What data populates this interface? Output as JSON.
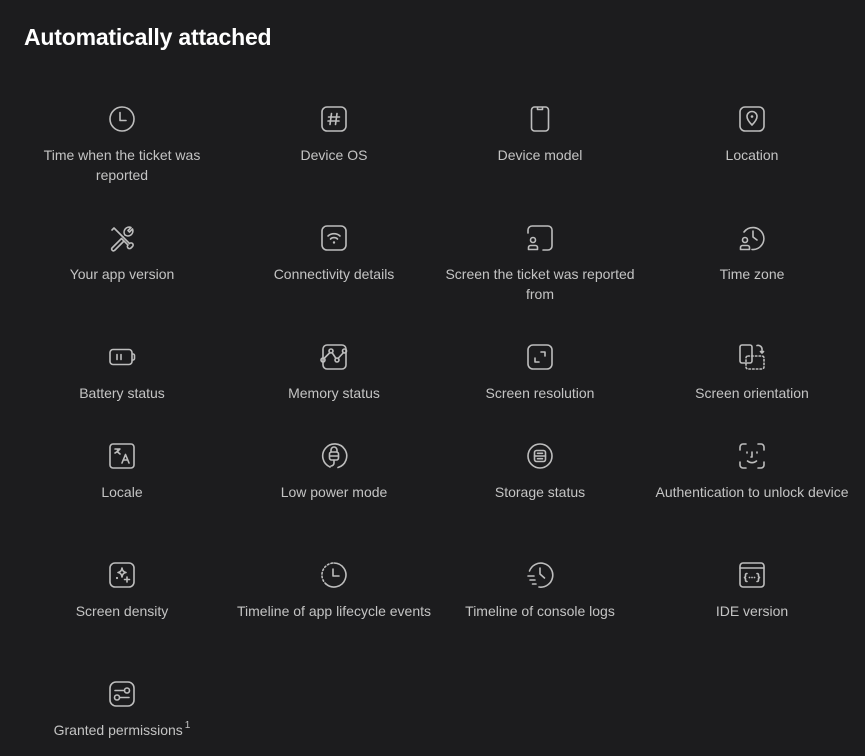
{
  "section_title": "Automatically attached",
  "items": [
    {
      "label": "Time when the ticket was reported",
      "icon": "clock-icon"
    },
    {
      "label": "Device OS",
      "icon": "hash-icon"
    },
    {
      "label": "Device model",
      "icon": "phone-icon"
    },
    {
      "label": "Location",
      "icon": "location-pin-icon"
    },
    {
      "label": "Your app version",
      "icon": "tools-icon"
    },
    {
      "label": "Connectivity details",
      "icon": "wifi-icon"
    },
    {
      "label": "Screen the ticket was reported from",
      "icon": "screen-user-icon"
    },
    {
      "label": "Time zone",
      "icon": "user-clock-icon"
    },
    {
      "label": "Battery status",
      "icon": "battery-icon"
    },
    {
      "label": "Memory status",
      "icon": "chart-graph-icon"
    },
    {
      "label": "Screen resolution",
      "icon": "resize-icon"
    },
    {
      "label": "Screen orientation",
      "icon": "rotate-screen-icon"
    },
    {
      "label": "Locale",
      "icon": "translate-icon"
    },
    {
      "label": "Low power mode",
      "icon": "plug-icon"
    },
    {
      "label": "Storage status",
      "icon": "storage-icon"
    },
    {
      "label": "Authentication to unlock device",
      "icon": "face-id-icon"
    },
    {
      "label": "Screen density",
      "icon": "sparkles-icon"
    },
    {
      "label": "Timeline of app lifecycle events",
      "icon": "dotted-clock-icon"
    },
    {
      "label": "Timeline of console logs",
      "icon": "history-lines-icon"
    },
    {
      "label": "IDE version",
      "icon": "code-window-icon"
    },
    {
      "label": "Granted permissions",
      "icon": "toggles-icon",
      "footnote": "1"
    }
  ]
}
